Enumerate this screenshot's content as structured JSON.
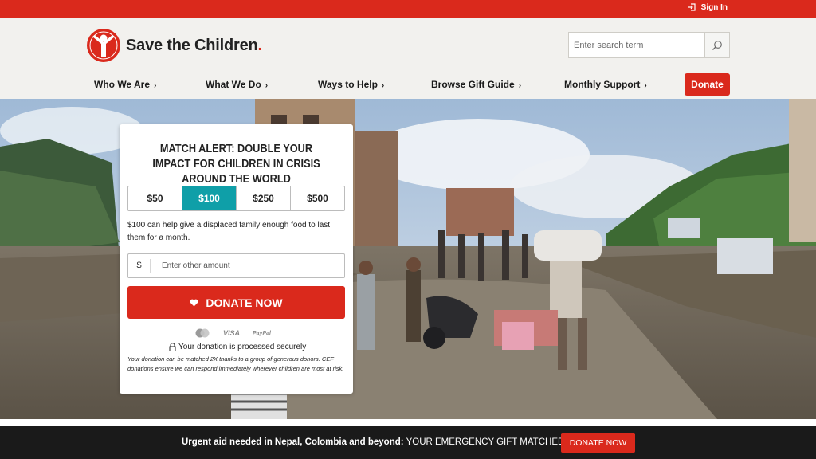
{
  "topbar": {
    "signin_label": "Sign In"
  },
  "header": {
    "logo_text": "Save the Children",
    "logo_dot": ".",
    "search": {
      "placeholder": "Enter search term"
    }
  },
  "nav": {
    "items": [
      {
        "label": "Who We Are"
      },
      {
        "label": "What We Do"
      },
      {
        "label": "Ways to Help"
      },
      {
        "label": "Browse Gift Guide"
      },
      {
        "label": "Monthly Support"
      }
    ],
    "chevron": "›",
    "donate_label": "Donate"
  },
  "donation_card": {
    "title": "MATCH ALERT: DOUBLE YOUR IMPACT FOR CHILDREN IN CRISIS AROUND THE WORLD",
    "amounts": [
      "$50",
      "$100",
      "$250",
      "$500"
    ],
    "selected_amount": "$100",
    "amount_description": "$100 can help give a displaced family enough food to last them for a month.",
    "currency_symbol": "$",
    "other_amount_placeholder": "Enter other amount",
    "donate_button_label": "DONATE NOW",
    "payment_methods": [
      "mastercard",
      "VISA",
      "PayPal"
    ],
    "secure_text": "Your donation is processed securely",
    "fine_print": "Your donation can be matched 2X thanks to a group of generous donors. CEF donations ensure we can respond immediately wherever children are most at risk."
  },
  "bottom_banner": {
    "bold_text": "Urgent aid needed in Nepal, Colombia and beyond:",
    "text": " YOUR EMERGENCY GIFT MATCHED 2X",
    "button_label": "DONATE NOW"
  },
  "colors": {
    "brand_red": "#da291c",
    "selected_teal": "#0f9fa8",
    "bottom_bar": "#1a1a1a"
  }
}
